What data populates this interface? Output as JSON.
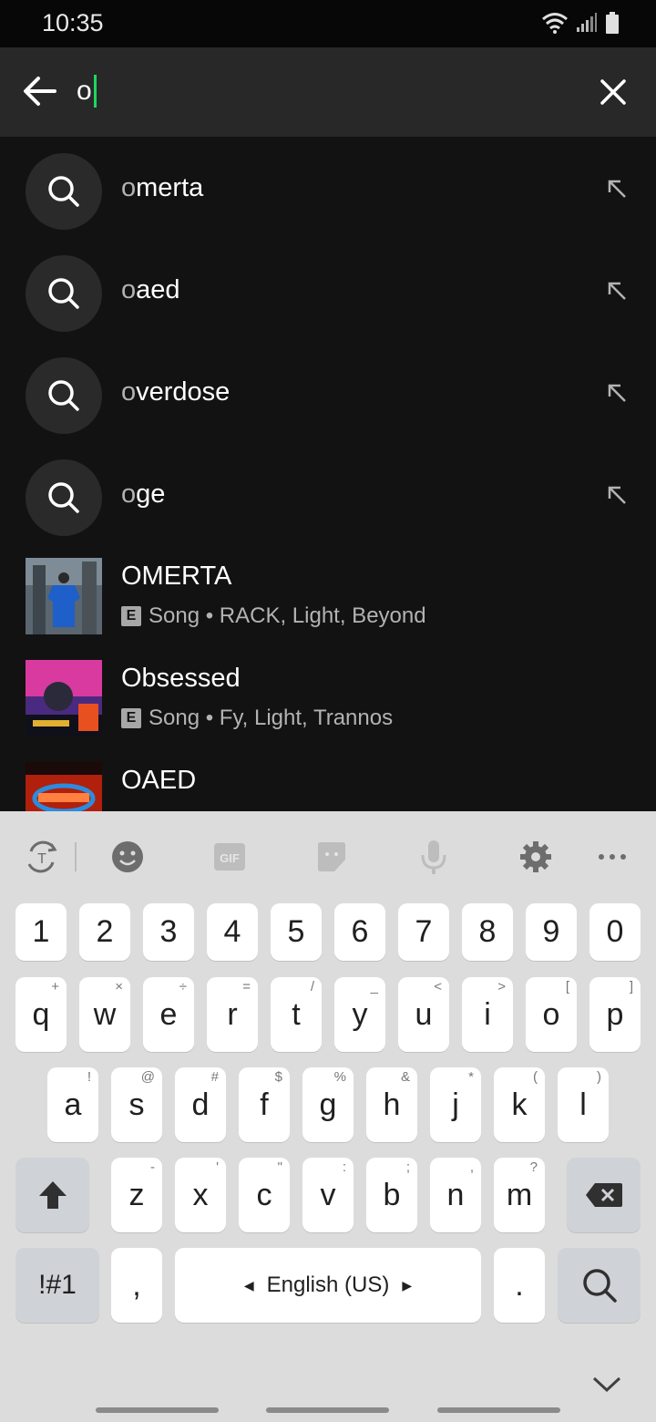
{
  "status": {
    "time": "10:35"
  },
  "search": {
    "query": "o"
  },
  "suggestions": [
    {
      "prefix": "o",
      "rest": "merta"
    },
    {
      "prefix": "o",
      "rest": "aed"
    },
    {
      "prefix": "o",
      "rest": "verdose"
    },
    {
      "prefix": "o",
      "rest": "ge"
    }
  ],
  "songs": [
    {
      "title": "OMERTA",
      "badge": "E",
      "subtitle": "Song • RACK, Light, Beyond"
    },
    {
      "title": "Obsessed",
      "badge": "E",
      "subtitle": "Song • Fy, Light, Trannos"
    },
    {
      "title": "OAED"
    }
  ],
  "keyboard": {
    "toolbar": {
      "gif_label": "GIF"
    },
    "numbers": [
      "1",
      "2",
      "3",
      "4",
      "5",
      "6",
      "7",
      "8",
      "9",
      "0"
    ],
    "row1": [
      {
        "k": "q",
        "h": "+"
      },
      {
        "k": "w",
        "h": "×"
      },
      {
        "k": "e",
        "h": "÷"
      },
      {
        "k": "r",
        "h": "="
      },
      {
        "k": "t",
        "h": "/"
      },
      {
        "k": "y",
        "h": "_"
      },
      {
        "k": "u",
        "h": "<"
      },
      {
        "k": "i",
        "h": ">"
      },
      {
        "k": "o",
        "h": "["
      },
      {
        "k": "p",
        "h": "]"
      }
    ],
    "row2": [
      {
        "k": "a",
        "h": "!"
      },
      {
        "k": "s",
        "h": "@"
      },
      {
        "k": "d",
        "h": "#"
      },
      {
        "k": "f",
        "h": "$"
      },
      {
        "k": "g",
        "h": "%"
      },
      {
        "k": "h",
        "h": "&"
      },
      {
        "k": "j",
        "h": "*"
      },
      {
        "k": "k",
        "h": "("
      },
      {
        "k": "l",
        "h": ")"
      }
    ],
    "row3": [
      {
        "k": "z",
        "h": "-"
      },
      {
        "k": "x",
        "h": "'"
      },
      {
        "k": "c",
        "h": "\""
      },
      {
        "k": "v",
        "h": ":"
      },
      {
        "k": "b",
        "h": ";"
      },
      {
        "k": "n",
        "h": ","
      },
      {
        "k": "m",
        "h": "?"
      }
    ],
    "symbols_label": "!#1",
    "comma_label": ",",
    "space_label": "English (US)",
    "period_label": "."
  },
  "colors": {
    "accent": "#1ed760",
    "background": "#121212",
    "searchbar": "#282828"
  }
}
